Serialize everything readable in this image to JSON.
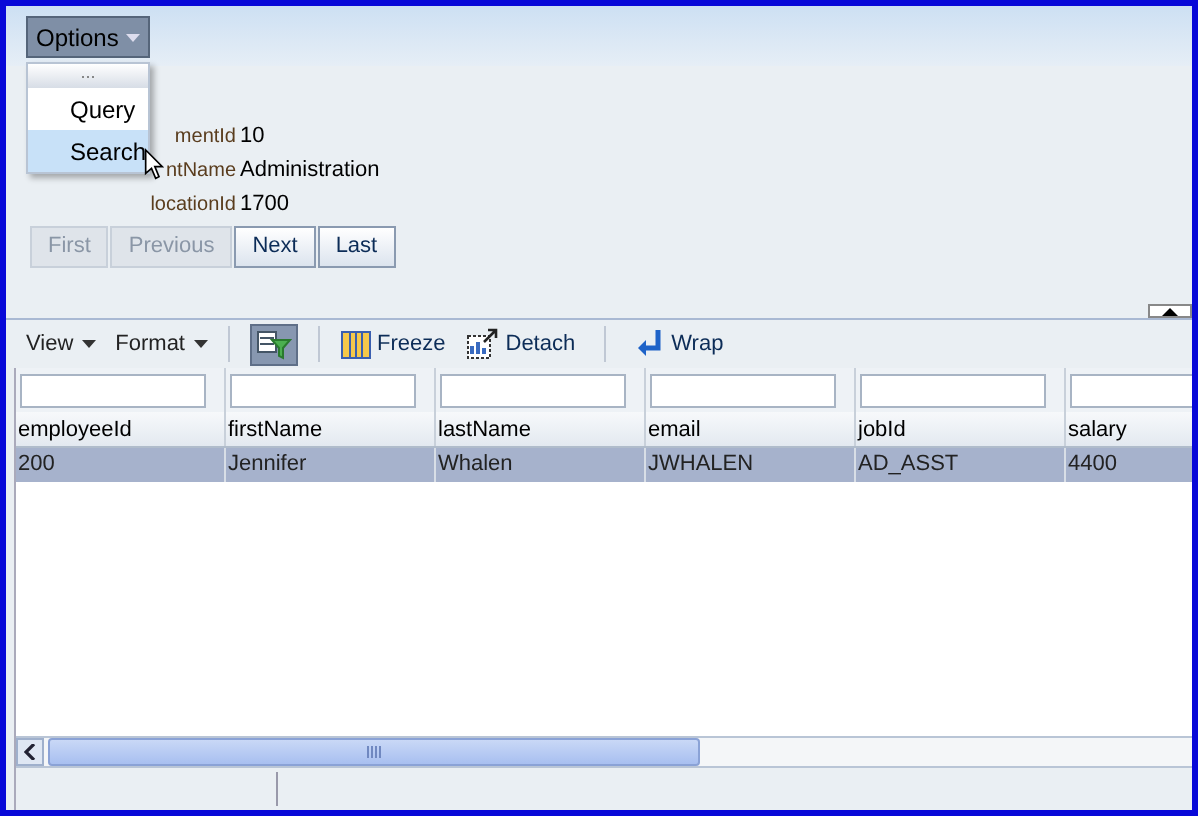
{
  "menu_button": {
    "label": "Options"
  },
  "menu": {
    "items": [
      {
        "kind": "grip",
        "label": "..."
      },
      {
        "kind": "item",
        "label": "Query",
        "selected": false
      },
      {
        "kind": "item",
        "label": "Search",
        "selected": true
      }
    ]
  },
  "form": {
    "fields": [
      {
        "label": "mentId",
        "value": "10"
      },
      {
        "label": "ntName",
        "value": "Administration"
      },
      {
        "label": "locationId",
        "value": "1700"
      }
    ]
  },
  "navigation": [
    {
      "label": "First",
      "disabled": true
    },
    {
      "label": "Previous",
      "disabled": true
    },
    {
      "label": "Next",
      "disabled": false
    },
    {
      "label": "Last",
      "disabled": false
    }
  ],
  "toolbar": {
    "items": [
      {
        "kind": "menu",
        "label": "View"
      },
      {
        "kind": "menu",
        "label": "Format"
      },
      {
        "kind": "filter",
        "selected": true
      },
      {
        "kind": "freeze",
        "label": "Freeze"
      },
      {
        "kind": "detach",
        "label": "Detach"
      },
      {
        "kind": "wrap",
        "label": "Wrap"
      }
    ]
  },
  "table": {
    "columns": [
      "employeeId",
      "firstName",
      "lastName",
      "email",
      "jobId",
      "salary"
    ],
    "rows": [
      {
        "cells": [
          "200",
          "Jennifer",
          "Whalen",
          "JWHALEN",
          "AD_ASST",
          "4400"
        ],
        "selected": true
      }
    ]
  }
}
